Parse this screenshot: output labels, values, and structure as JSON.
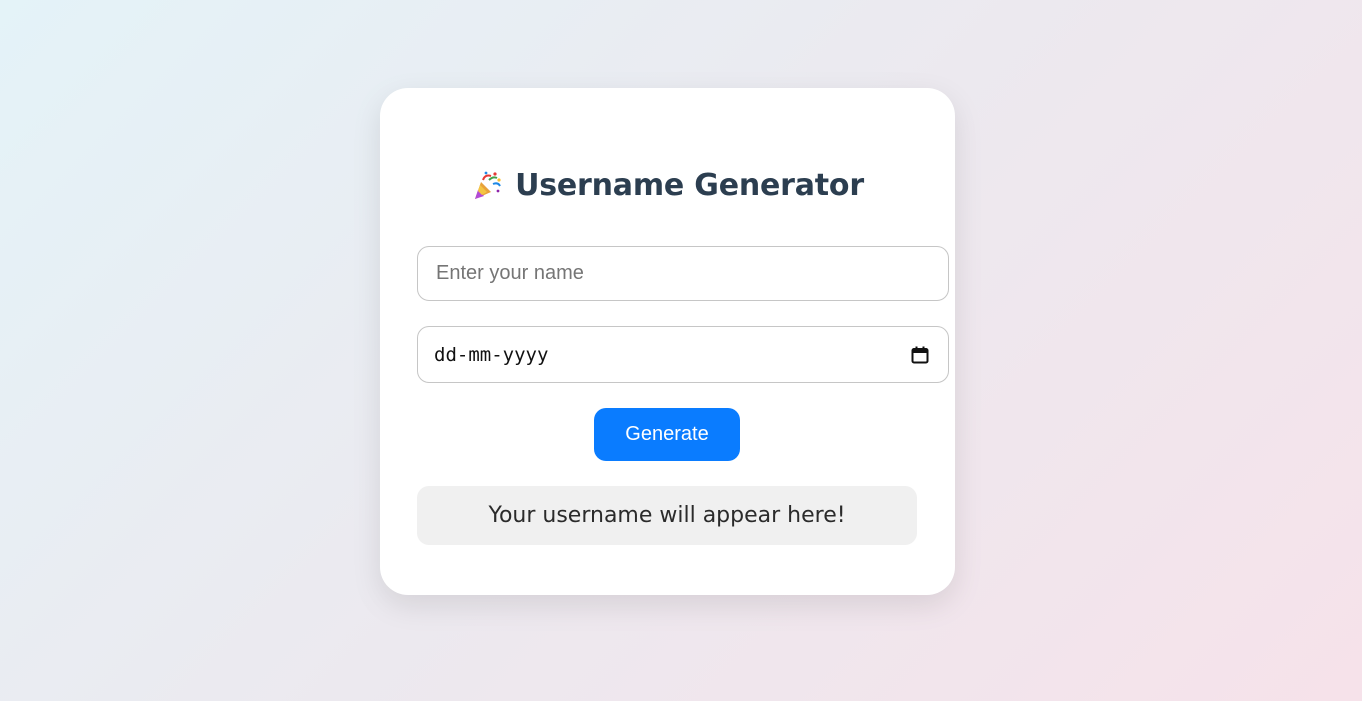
{
  "header": {
    "title": "Username Generator",
    "icon": "party-popper-icon"
  },
  "form": {
    "name_placeholder": "Enter your name",
    "name_value": "",
    "date_placeholder": "dd-mm-yyyy",
    "date_icon": "calendar-icon",
    "generate_label": "Generate"
  },
  "result": {
    "text": "Your username will appear here!"
  },
  "colors": {
    "accent": "#0a7cff",
    "title": "#2c3e50",
    "result_bg": "#f0f0f0"
  }
}
